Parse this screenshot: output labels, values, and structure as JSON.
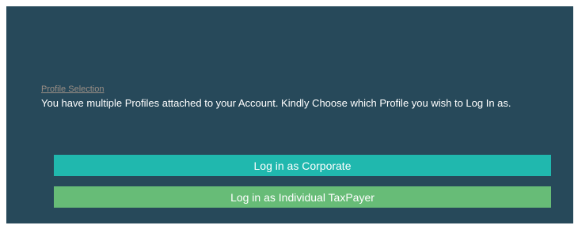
{
  "profile_selection": {
    "link_text": "Profile Selection",
    "message": "You have multiple Profiles attached to your Account. Kindly Choose which Profile you wish to Log In as."
  },
  "buttons": {
    "corporate": {
      "label": "Log in as Corporate",
      "color": "#20b8ae"
    },
    "individual": {
      "label": "Log in as Individual TaxPayer",
      "color": "#67bc77"
    }
  },
  "colors": {
    "panel_background": "#27495a",
    "link": "#9b8f86",
    "text": "#ffffff"
  }
}
